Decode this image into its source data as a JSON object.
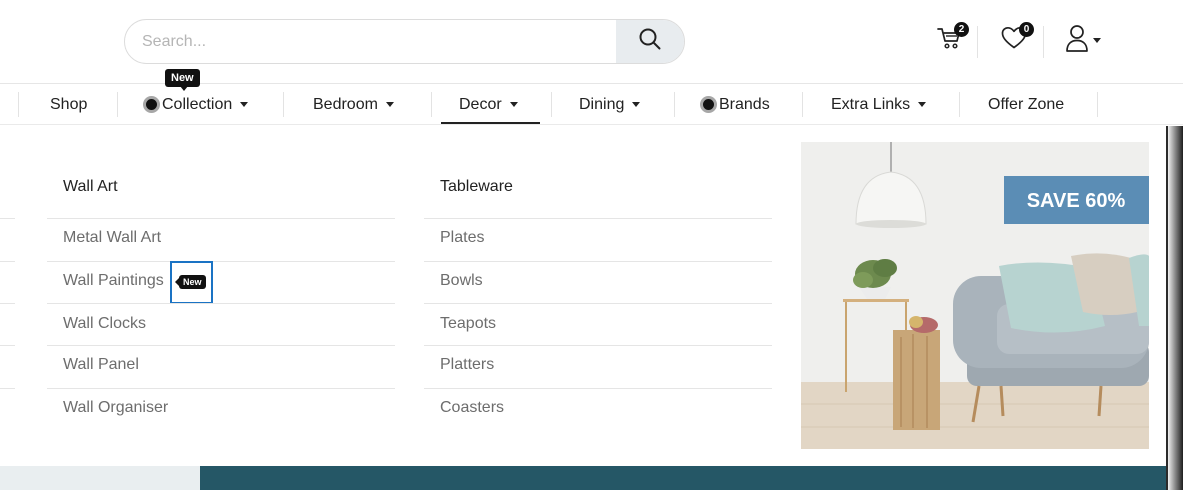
{
  "search": {
    "placeholder": "Search..."
  },
  "header": {
    "cart_count": "2",
    "wishlist_count": "0",
    "icons": [
      "search-icon",
      "cart-icon",
      "heart-icon",
      "user-icon",
      "chevron-down-icon"
    ]
  },
  "nav": {
    "items": [
      {
        "label": "Shop"
      },
      {
        "label": "Collection",
        "tag": "New"
      },
      {
        "label": "Bedroom"
      },
      {
        "label": "Decor"
      },
      {
        "label": "Dining"
      },
      {
        "label": "Brands"
      },
      {
        "label": "Extra Links"
      },
      {
        "label": "Offer Zone"
      }
    ],
    "active": "Decor"
  },
  "mega_menu": {
    "columns": [
      {
        "title": "Wall Art",
        "links": [
          {
            "label": "Metal Wall Art"
          },
          {
            "label": "Wall Paintings",
            "tag": "New"
          },
          {
            "label": "Wall Clocks"
          },
          {
            "label": "Wall Panel"
          },
          {
            "label": "Wall Organiser"
          }
        ]
      },
      {
        "title": "Tableware",
        "links": [
          {
            "label": "Plates"
          },
          {
            "label": "Bowls"
          },
          {
            "label": "Teapots"
          },
          {
            "label": "Platters"
          },
          {
            "label": "Coasters"
          }
        ]
      }
    ],
    "promo": {
      "text": "SAVE 60%"
    }
  },
  "colors": {
    "accent": "#1a73c4",
    "promo_banner": "#5b8db5",
    "badge": "#111111",
    "sofa": "#a9b3bb"
  }
}
